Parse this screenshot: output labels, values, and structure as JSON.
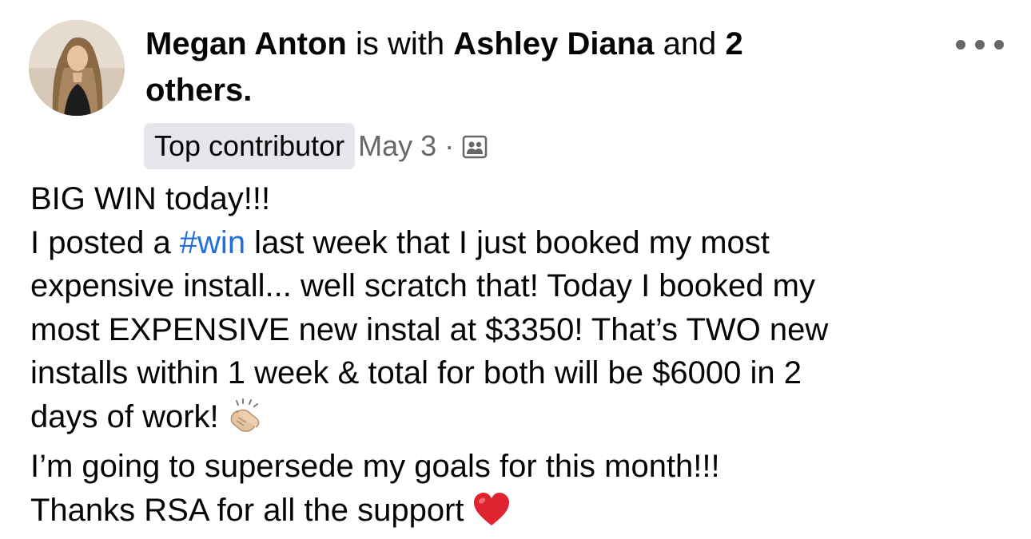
{
  "post": {
    "author": "Megan Anton",
    "with_text": "is with",
    "tagged_person": "Ashley Diana",
    "and_text": "and",
    "others_count": "2",
    "others_text": "others.",
    "badge": "Top contributor",
    "date": "May 3",
    "separator": "·",
    "audience_icon": "group-audience-icon",
    "more_icon": "more-options-icon",
    "body": {
      "line1": "BIG WIN today!!!",
      "line2_before": "I posted a ",
      "hashtag": "#win",
      "line2_after": " last week that I just booked my most",
      "line3": "expensive install... well scratch that! Today I booked my",
      "line4": "most EXPENSIVE new instal at $3350!  That’s TWO new",
      "line5": "installs within 1 week & total for both will be $6000 in 2",
      "line6": "days of work!",
      "line6_emoji": "clapping-hands-emoji",
      "line7": "I’m going to supersede my goals for this month!!!",
      "line8": "Thanks RSA for all the support",
      "line8_emoji": "red-heart-emoji"
    }
  },
  "colors": {
    "text": "#050505",
    "secondary": "#65676b",
    "badge_bg": "#e4e6eb",
    "hashtag": "#216fdb",
    "heart": "#e0242f"
  }
}
